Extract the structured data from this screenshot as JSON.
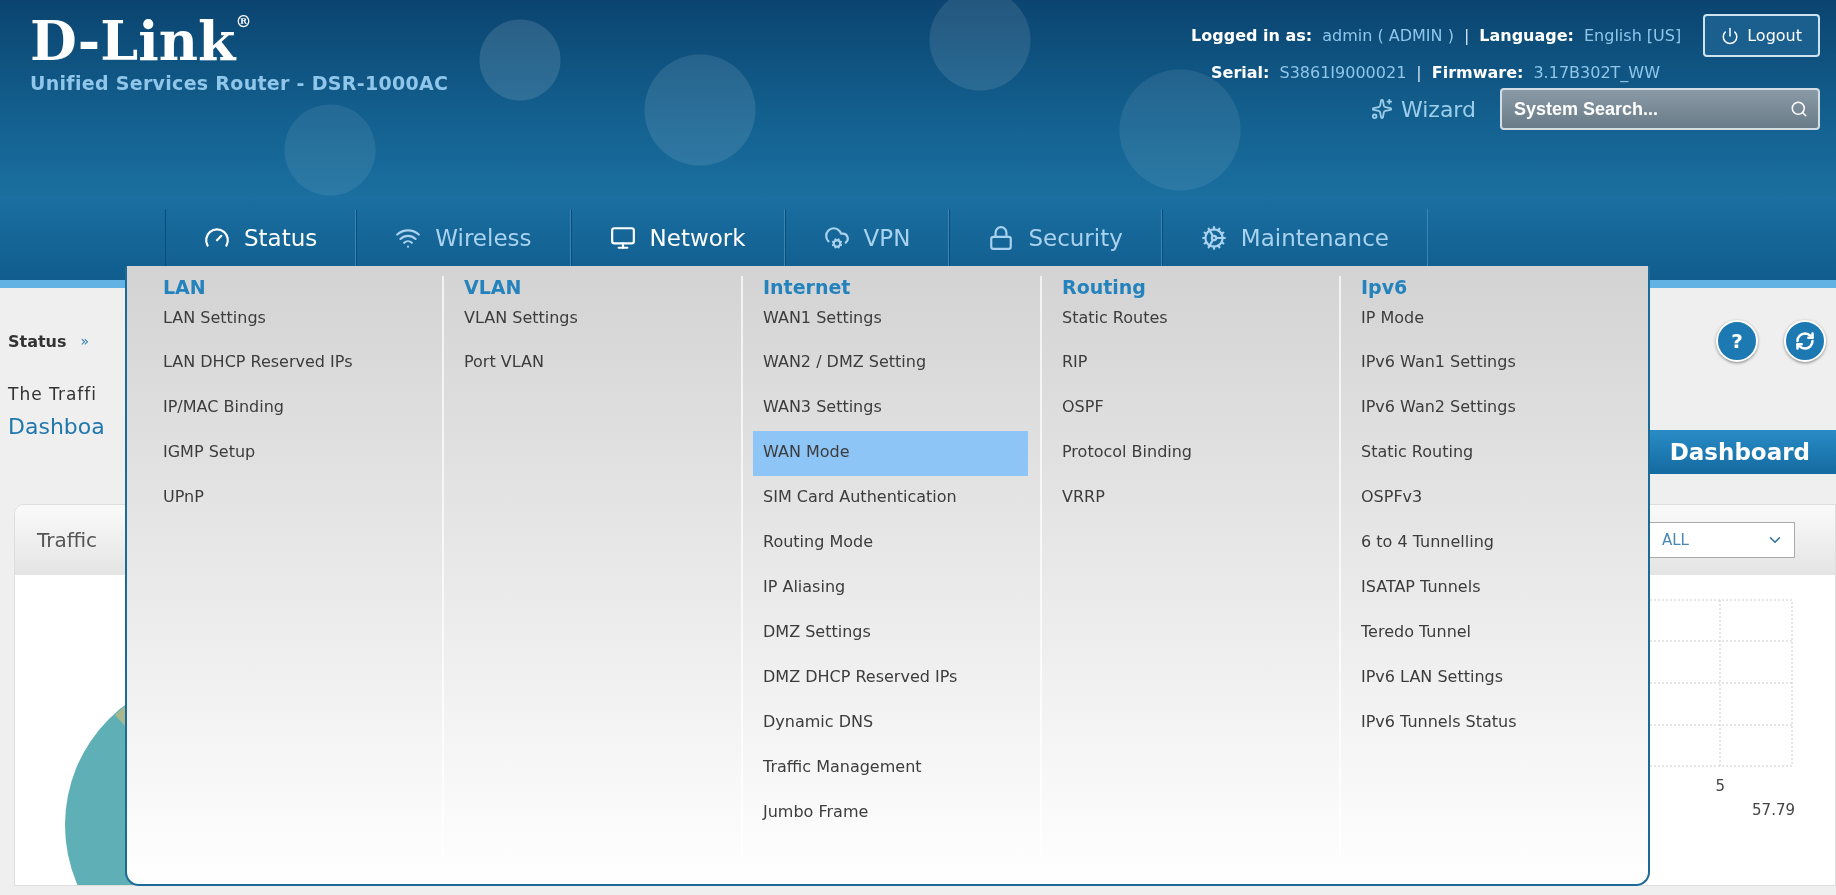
{
  "header": {
    "brand": "D-Link",
    "brand_mark": "®",
    "subtitle": "Unified Services Router - DSR-1000AC",
    "login_label": "Logged in as:",
    "user": "admin ( ADMIN )",
    "separator": "|",
    "language_label": "Language:",
    "language": "English [US]",
    "logout": "Logout",
    "serial_label": "Serial:",
    "serial": "S3861I9000021",
    "firmware_label": "Firmware:",
    "firmware": "3.17B302T_WW",
    "wizard": "Wizard",
    "search": {
      "placeholder": "System Search..."
    }
  },
  "nav": [
    {
      "label": "Status",
      "highlighted": true
    },
    {
      "label": "Wireless",
      "highlighted": false
    },
    {
      "label": "Network",
      "highlighted": true
    },
    {
      "label": "VPN",
      "highlighted": false
    },
    {
      "label": "Security",
      "highlighted": false
    },
    {
      "label": "Maintenance",
      "highlighted": false
    }
  ],
  "page": {
    "breadcrumb": "Status",
    "breadcrumb_sep": "»",
    "help_glyph": "?",
    "intro": "The Traffi",
    "heading": "Dashboa",
    "dashboard_button": "Dashboard",
    "card_title": "Traffic",
    "filter": "ALL",
    "axis_label": "5",
    "reading": "57.79"
  },
  "menu": [
    {
      "heading": "LAN",
      "items": [
        {
          "label": "LAN Settings",
          "selected": false
        },
        {
          "label": "LAN DHCP Reserved IPs",
          "selected": false
        },
        {
          "label": "IP/MAC Binding",
          "selected": false
        },
        {
          "label": "IGMP Setup",
          "selected": false
        },
        {
          "label": "UPnP",
          "selected": false
        }
      ]
    },
    {
      "heading": "VLAN",
      "items": [
        {
          "label": "VLAN Settings",
          "selected": false
        },
        {
          "label": "Port VLAN",
          "selected": false
        }
      ]
    },
    {
      "heading": "Internet",
      "items": [
        {
          "label": "WAN1 Settings",
          "selected": false
        },
        {
          "label": "WAN2 / DMZ Setting",
          "selected": false
        },
        {
          "label": "WAN3 Settings",
          "selected": false
        },
        {
          "label": "WAN Mode",
          "selected": true
        },
        {
          "label": "SIM Card Authentication",
          "selected": false
        },
        {
          "label": "Routing Mode",
          "selected": false
        },
        {
          "label": "IP Aliasing",
          "selected": false
        },
        {
          "label": "DMZ Settings",
          "selected": false
        },
        {
          "label": "DMZ DHCP Reserved IPs",
          "selected": false
        },
        {
          "label": "Dynamic DNS",
          "selected": false
        },
        {
          "label": "Traffic Management",
          "selected": false
        },
        {
          "label": "Jumbo Frame",
          "selected": false
        }
      ]
    },
    {
      "heading": "Routing",
      "items": [
        {
          "label": "Static Routes",
          "selected": false
        },
        {
          "label": "RIP",
          "selected": false
        },
        {
          "label": "OSPF",
          "selected": false
        },
        {
          "label": "Protocol Binding",
          "selected": false
        },
        {
          "label": "VRRP",
          "selected": false
        }
      ]
    },
    {
      "heading": "Ipv6",
      "items": [
        {
          "label": "IP Mode",
          "selected": false
        },
        {
          "label": "IPv6 Wan1 Settings",
          "selected": false
        },
        {
          "label": "IPv6 Wan2 Settings",
          "selected": false
        },
        {
          "label": "Static Routing",
          "selected": false
        },
        {
          "label": "OSPFv3",
          "selected": false
        },
        {
          "label": "6 to 4 Tunnelling",
          "selected": false
        },
        {
          "label": "ISATAP Tunnels",
          "selected": false
        },
        {
          "label": "Teredo Tunnel",
          "selected": false
        },
        {
          "label": "IPv6 LAN Settings",
          "selected": false
        },
        {
          "label": "IPv6 Tunnels Status",
          "selected": false
        }
      ]
    }
  ]
}
